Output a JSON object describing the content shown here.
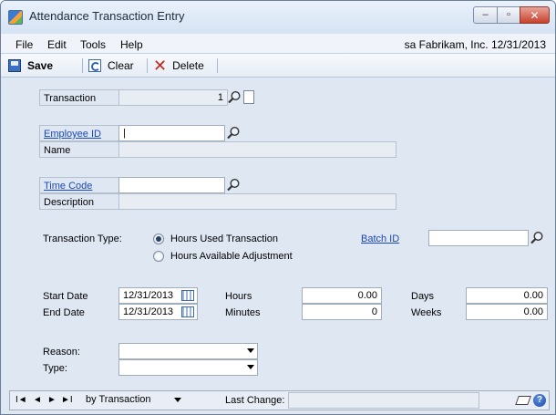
{
  "window": {
    "title": "Attendance Transaction Entry",
    "minimize_glyph": "–",
    "maximize_glyph": "▫",
    "close_glyph": "✕"
  },
  "menu": {
    "items": [
      "File",
      "Edit",
      "Tools",
      "Help"
    ],
    "context": "sa  Fabrikam, Inc.  12/31/2013"
  },
  "toolbar": {
    "save_label": "Save",
    "clear_label": "Clear",
    "delete_label": "Delete"
  },
  "form": {
    "transaction_label": "Transaction",
    "transaction_value": "1",
    "employee_id_label": "Employee ID",
    "employee_id_value": "|",
    "name_label": "Name",
    "name_value": "",
    "time_code_label": "Time Code",
    "time_code_value": "",
    "description_label": "Description",
    "description_value": "",
    "transaction_type_label": "Transaction Type:",
    "radio_hours_used": "Hours Used Transaction",
    "radio_hours_available": "Hours Available Adjustment",
    "selected_transaction_type": "Hours Used Transaction",
    "batch_id_label": "Batch ID",
    "batch_id_value": "",
    "start_date_label": "Start Date",
    "start_date_value": "12/31/2013",
    "end_date_label": "End Date",
    "end_date_value": "12/31/2013",
    "hours_label": "Hours",
    "hours_value": "0.00",
    "minutes_label": "Minutes",
    "minutes_value": "0",
    "days_label": "Days",
    "days_value": "0.00",
    "weeks_label": "Weeks",
    "weeks_value": "0.00",
    "reason_label": "Reason:",
    "reason_value": "",
    "type_label": "Type:",
    "type_value": ""
  },
  "statusbar": {
    "nav_first": "I◄",
    "nav_prev": "◄",
    "nav_next": "►",
    "nav_last": "►I",
    "sort_value": "by Transaction",
    "last_change_label": "Last Change:",
    "last_change_value": "",
    "help_glyph": "?"
  },
  "icons": {
    "app": "app-icon",
    "save": "save-icon",
    "clear": "clear-icon",
    "delete": "delete-icon",
    "lookup": "magnifier-icon",
    "note": "note-icon",
    "calendar": "calendar-icon",
    "help": "help-icon"
  },
  "colors": {
    "link": "#1a48b8",
    "window_bg": "#dfe7f3",
    "delete_red": "#c8261c"
  }
}
